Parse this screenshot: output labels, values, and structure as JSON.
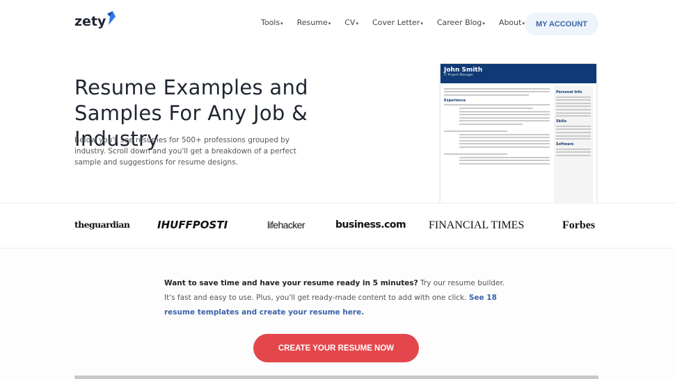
{
  "nav": {
    "logo": "zety",
    "items": [
      "Tools",
      "Resume",
      "CV",
      "Cover Letter",
      "Career Blog",
      "About"
    ],
    "account": "MY ACCOUNT"
  },
  "hero": {
    "title": "Resume Examples and Samples For Any Job & Industry",
    "intro": "Below you'll see resumes for 500+ professions grouped by industry. Scroll down and you'll get a breakdown of a perfect sample and suggestions for resume designs."
  },
  "resume_preview": {
    "name": "John Smith",
    "title": "IT Project Manager",
    "sections": [
      "Experience",
      "Personal Info",
      "Skills",
      "Software"
    ]
  },
  "partners": [
    "theguardian",
    "IHUFFPOSTI",
    "lifehacker",
    "business.com",
    "FINANCIAL TIMES",
    "Forbes"
  ],
  "pitch": {
    "bold": "Want to save time and have your resume ready in 5 minutes?",
    "text": " Try our resume builder. It's fast and easy to use. Plus, you'll get ready-made content to add with one click. ",
    "link": "See 18 resume templates and create your resume here."
  },
  "cta": "CREATE YOUR RESUME NOW",
  "colors": {
    "accent": "#3b63a8",
    "cta": "#e4474b",
    "resume_header": "#0f3a75"
  }
}
